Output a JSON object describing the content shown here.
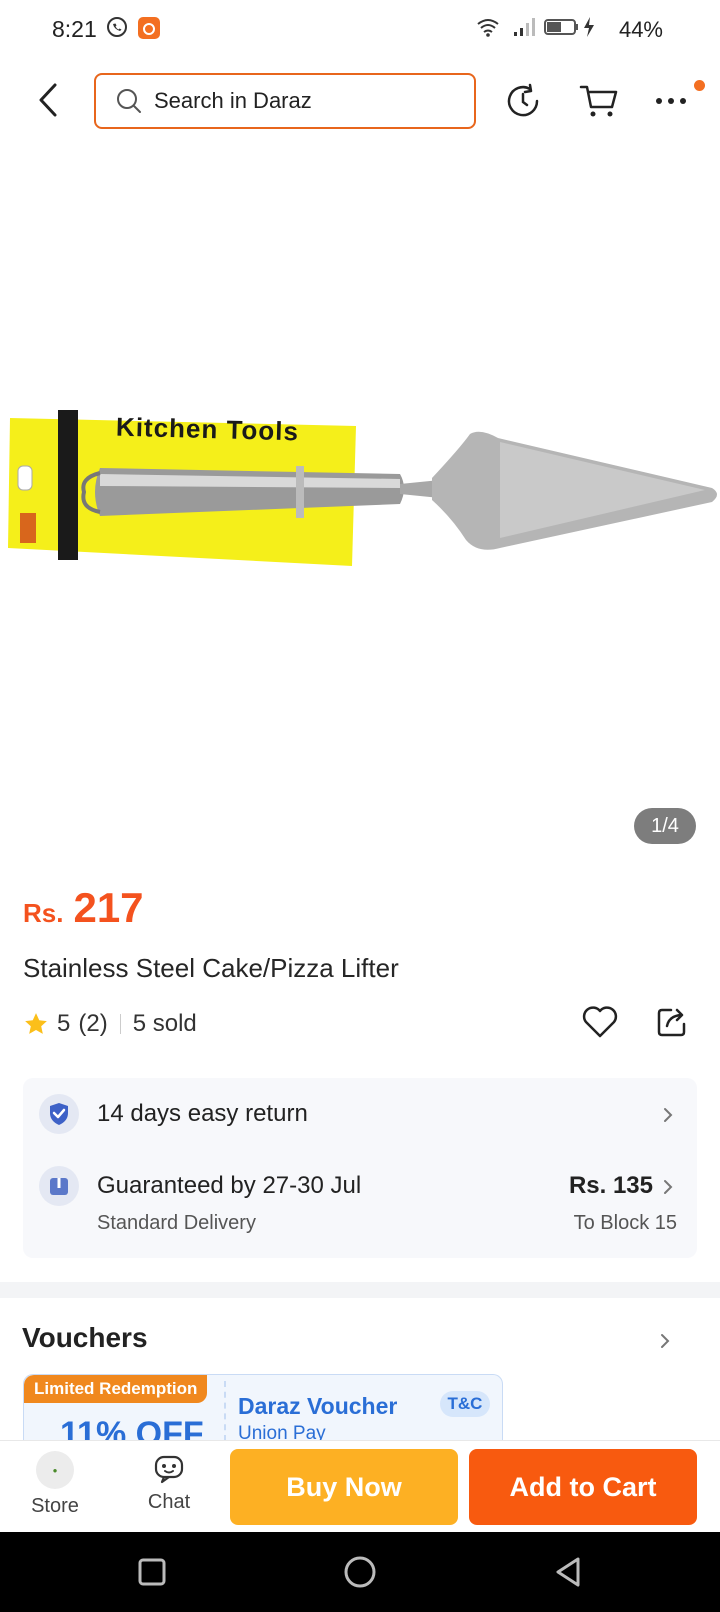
{
  "status_bar": {
    "time": "8:21",
    "battery": "44%"
  },
  "header": {
    "search_placeholder": "Search in Daraz"
  },
  "product": {
    "image_counter": "1/4",
    "image_package_text": "Kitchen Tools",
    "price_currency": "Rs.",
    "price_value": "217",
    "title": "Stainless Steel Cake/Pizza Lifter",
    "rating": "5",
    "review_count": "(2)",
    "sold": "5 sold"
  },
  "delivery": {
    "return_text": "14 days easy return",
    "guarantee_text": "Guaranteed by 27-30 Jul",
    "delivery_type": "Standard Delivery",
    "delivery_fee": "Rs. 135",
    "destination": "To Block 15"
  },
  "vouchers": {
    "title": "Vouchers",
    "tag": "Limited Redemption",
    "partial_value": "11% OFF",
    "name": "Daraz Voucher",
    "sub": "Union Pay",
    "tc": "T&C"
  },
  "actions": {
    "store_label": "Store",
    "chat_label": "Chat",
    "buy_now": "Buy Now",
    "add_to_cart": "Add to Cart"
  },
  "colors": {
    "accent": "#f4521e",
    "buy_now": "#fdb023",
    "add_to_cart": "#f85a0f",
    "voucher_blue": "#2a6ed6"
  }
}
